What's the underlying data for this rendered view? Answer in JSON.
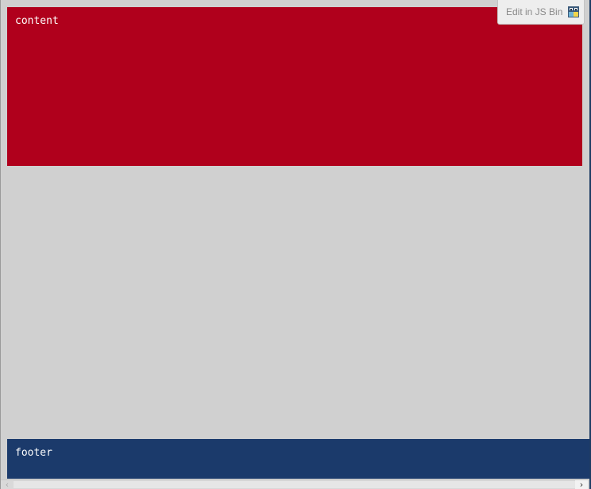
{
  "content": {
    "label": "content"
  },
  "footer": {
    "label": "footer"
  },
  "jsbin": {
    "label": "Edit in JS Bin",
    "icon": "jsbin-logo-icon"
  },
  "scrollbar": {
    "left_arrow": "‹",
    "right_arrow": "›"
  },
  "colors": {
    "content_bg": "#b0001c",
    "footer_bg": "#1b3a6b",
    "page_bg": "#d0d0d0"
  }
}
